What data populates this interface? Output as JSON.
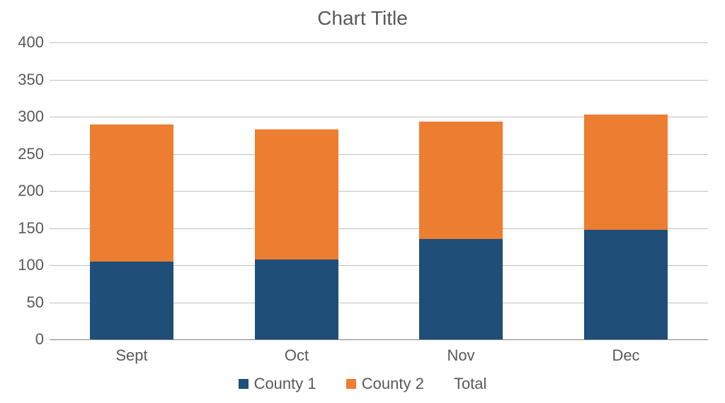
{
  "chart_data": {
    "type": "bar",
    "stacked": true,
    "title": "Chart Title",
    "xlabel": "",
    "ylabel": "",
    "categories": [
      "Sept",
      "Oct",
      "Nov",
      "Dec"
    ],
    "series": [
      {
        "name": "County 1",
        "color": "#1f4e79",
        "values": [
          105,
          108,
          135,
          148
        ]
      },
      {
        "name": "County 2",
        "color": "#ed7d31",
        "values": [
          185,
          175,
          158,
          155
        ]
      }
    ],
    "legend_extra": [
      "Total"
    ],
    "ylim": [
      0,
      400
    ],
    "yticks": [
      0,
      50,
      100,
      150,
      200,
      250,
      300,
      350,
      400
    ]
  }
}
